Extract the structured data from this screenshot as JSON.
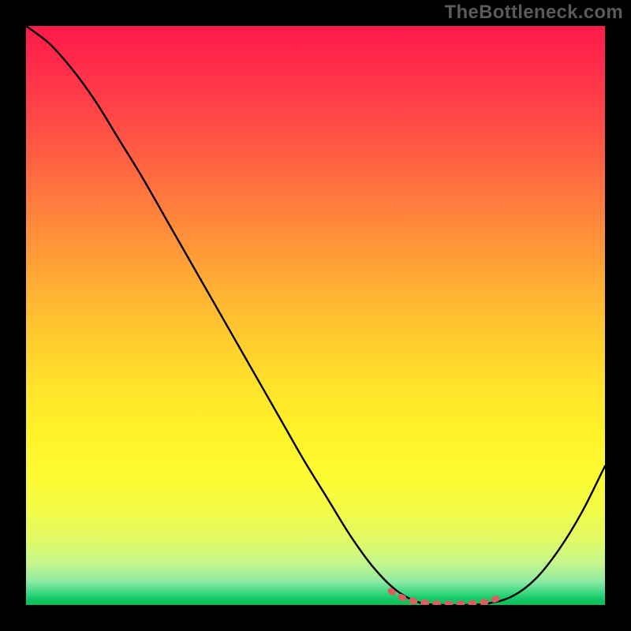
{
  "watermark": "TheBottleneck.com",
  "colors": {
    "marker": "#d86060",
    "curve": "#000000"
  },
  "chart_data": {
    "type": "line",
    "title": "",
    "xlabel": "",
    "ylabel": "",
    "xlim": [
      0,
      100
    ],
    "ylim": [
      0,
      100
    ],
    "series": [
      {
        "name": "bottleneck-curve",
        "x": [
          0,
          4,
          8,
          12,
          16,
          20,
          24,
          28,
          32,
          36,
          40,
          44,
          48,
          52,
          56,
          60,
          64,
          68,
          72,
          76,
          80,
          84,
          88,
          92,
          96,
          100
        ],
        "y": [
          100,
          97,
          92.5,
          87,
          80.5,
          74,
          67,
          60,
          53,
          46,
          39,
          32,
          25,
          18.5,
          12,
          6.5,
          2.5,
          0.4,
          0,
          0,
          0.3,
          1.5,
          4.5,
          9.5,
          16,
          24
        ]
      }
    ],
    "valley": {
      "x_start": 63,
      "x_end": 82,
      "y": 0.6,
      "points": [
        {
          "x": 63.0,
          "y": 2.4
        },
        {
          "x": 64.5,
          "y": 1.5
        },
        {
          "x": 66.0,
          "y": 0.9
        },
        {
          "x": 68.0,
          "y": 0.5
        },
        {
          "x": 70.5,
          "y": 0.25
        },
        {
          "x": 73.0,
          "y": 0.18
        },
        {
          "x": 75.0,
          "y": 0.18
        },
        {
          "x": 77.0,
          "y": 0.25
        },
        {
          "x": 79.0,
          "y": 0.45
        },
        {
          "x": 80.5,
          "y": 0.8
        },
        {
          "x": 82.0,
          "y": 1.4
        }
      ]
    },
    "marker_style": {
      "stroke_width": 8,
      "dasharray": "3 12"
    }
  }
}
